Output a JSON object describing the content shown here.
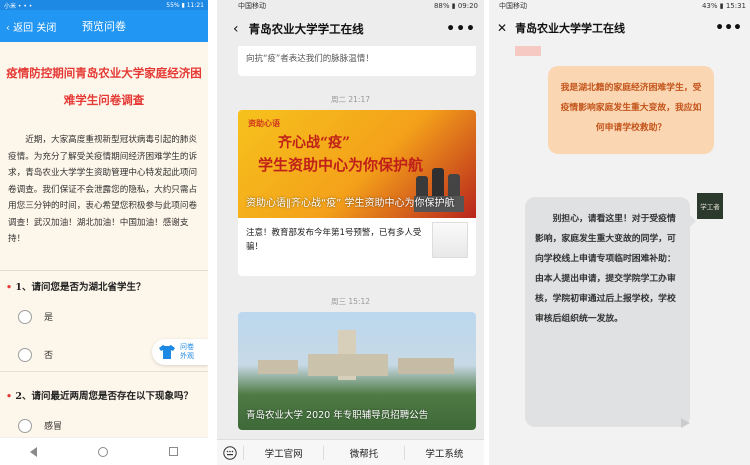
{
  "panel1": {
    "status": {
      "left": "小米 • • •",
      "right": "55% ▮ 11:21"
    },
    "nav": {
      "back_label": "‹ 返回 关闭",
      "title": "预览问卷"
    },
    "survey_title": "疫情防控期间青岛农业大学家庭经济困难学生问卷调查",
    "intro": "近期，大家高度重视新型冠状病毒引起的肺炎疫情。为充分了解受关疫情期间经济困难学生的诉求，青岛农业大学学生资助管理中心特发起此项问卷调查。我们保证不会泄露您的隐私，大约只需占用您三分钟的时间，衷心希望您积极参与此项问卷调查！武汉加油！湖北加油！中国加油！感谢支持！",
    "q1": {
      "req": "•",
      "label": "1、请问您是否为湖北省学生？",
      "options": [
        "是",
        "否"
      ]
    },
    "q2": {
      "req": "•",
      "label": "2、请问最近两周您是否存在以下现象吗？",
      "options": [
        "感冒"
      ]
    },
    "float_button": {
      "line1": "问卷",
      "line2": "外观"
    }
  },
  "panel2": {
    "status": {
      "left": "中国移动",
      "right": "88% ▮ 09:20"
    },
    "nav": {
      "title": "青岛农业大学学工在线",
      "more": "•••"
    },
    "top_card_text": "向抗“疫”者表达我们的脉脉温情！",
    "time1": "周二 21:17",
    "article1": {
      "tag": "资助心语",
      "banner_line1": "齐心战“疫”",
      "banner_line2": "学生资助中心为你保护航",
      "caption": "资助心语‖齐心战“疫” 学生资助中心为你保护航",
      "sub_text": "注意！教育部发布今年第1号预警，已有多人受骗！"
    },
    "time2": "周三 15:12",
    "article2": {
      "caption": "青岛农业大学 2020 年专职辅导员招聘公告"
    },
    "bottom_menu": [
      "学工官网",
      "微帮托",
      "学工系统"
    ]
  },
  "panel3": {
    "status": {
      "left": "中国移动",
      "right": "43% ▮ 15:31"
    },
    "nav": {
      "close": "✕",
      "title": "青岛农业大学学工在线",
      "more": "•••"
    },
    "bubble_out": "我是湖北籍的家庭经济困难学生，受疫情影响家庭发生重大变故，我应如何申请学校救助？",
    "bubble_in": "别担心，请看这里！对于受疫情影响，家庭发生重大变故的同学，可向学校线上申请专项临时困难补助：由本人提出申请，提交学院学工办审核，学院初审通过后上报学校，学校审核后组织统一发放。",
    "avatar_text": "学工者"
  },
  "colors": {
    "nav_blue": "#2196f3",
    "title_red": "#e53935",
    "bubble_orange": "#fbd6b3"
  }
}
